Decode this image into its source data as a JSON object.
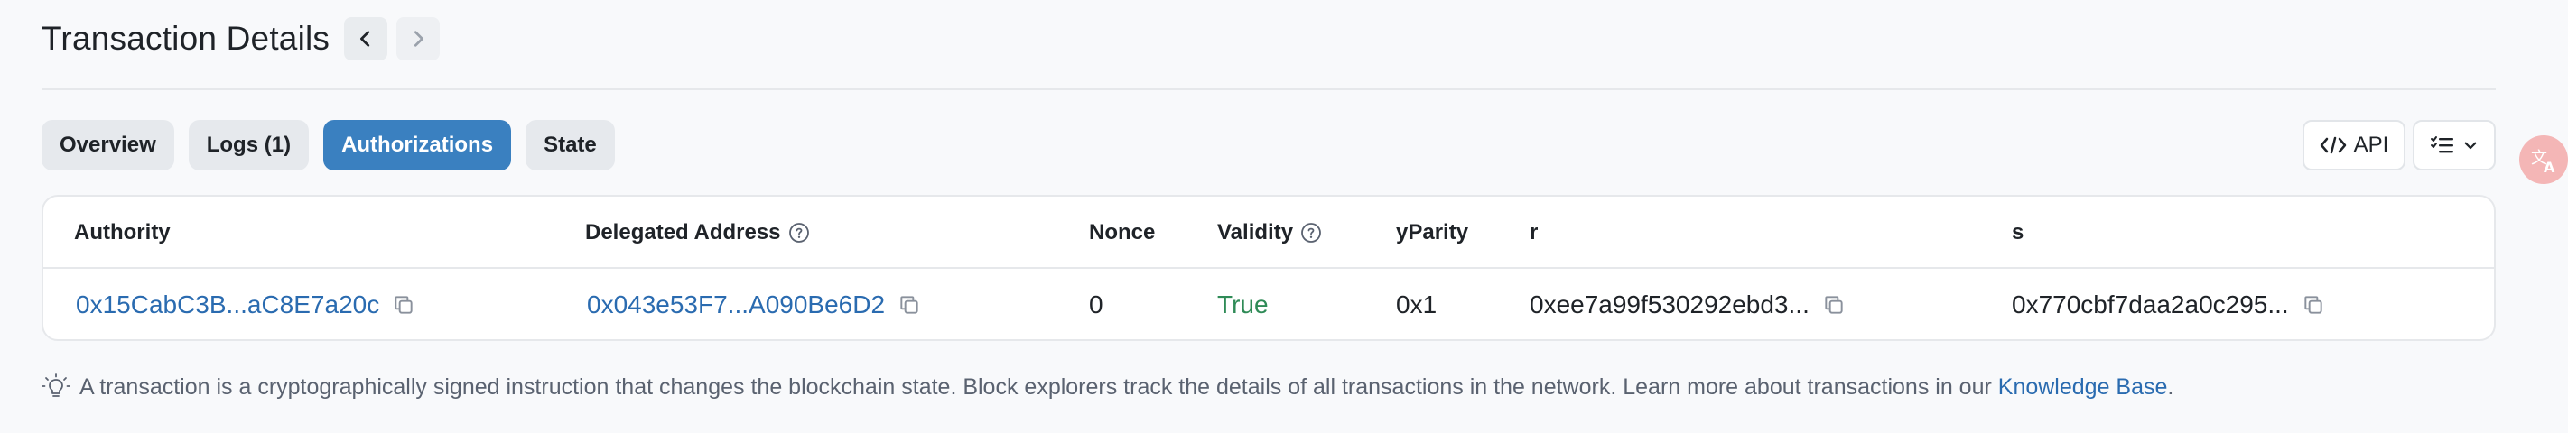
{
  "header": {
    "title": "Transaction Details",
    "prev_icon": "chevron-left-icon",
    "next_icon": "chevron-right-icon"
  },
  "tabs": [
    {
      "label": "Overview",
      "active": false
    },
    {
      "label": "Logs (1)",
      "active": false
    },
    {
      "label": "Authorizations",
      "active": true
    },
    {
      "label": "State",
      "active": false
    }
  ],
  "tools": {
    "api_label": "API",
    "api_icon": "code-icon",
    "columns_icon": "list-check-icon",
    "dropdown_icon": "chevron-down-icon"
  },
  "table": {
    "headers": {
      "authority": "Authority",
      "delegated_address": "Delegated Address",
      "nonce": "Nonce",
      "validity": "Validity",
      "yparity": "yParity",
      "r": "r",
      "s": "s"
    },
    "row": {
      "authority": "0x15CabC3B...aC8E7a20c",
      "delegated_address": "0x043e53F7...A090Be6D2",
      "nonce": "0",
      "validity": "True",
      "yparity": "0x1",
      "r": "0xee7a99f530292ebd3...",
      "s": "0x770cbf7daa2a0c295..."
    }
  },
  "footer": {
    "text": "A transaction is a cryptographically signed instruction that changes the blockchain state. Block explorers track the details of all transactions in the network. Learn more about transactions in our",
    "link_label": "Knowledge Base",
    "end": "."
  },
  "colors": {
    "accent": "#3a80c0",
    "link": "#2a6bb0",
    "valid": "#2f8b57"
  }
}
